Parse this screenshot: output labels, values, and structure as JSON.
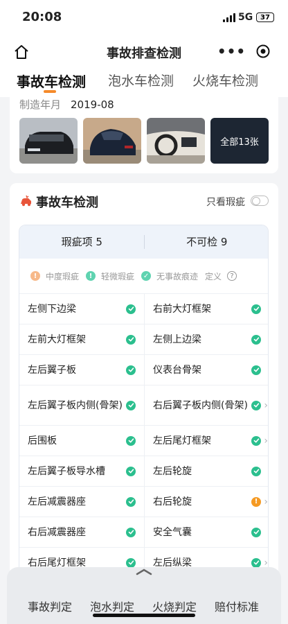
{
  "status_bar": {
    "time": "20:08",
    "network": "5G",
    "battery": "37",
    "battery_level": 0.37
  },
  "nav": {
    "title": "事故排查检测",
    "more_icon": "more-dots-icon",
    "close_icon": "target-icon",
    "home_icon": "home-icon"
  },
  "tabs": [
    {
      "label": "事故车检测",
      "active": true
    },
    {
      "label": "泡水车检测",
      "active": false
    },
    {
      "label": "火烧车检测",
      "active": false
    }
  ],
  "vehicle": {
    "mfg_label": "制造年月",
    "mfg_value": "2019-08",
    "photos": [
      "car-front-photo",
      "car-rear-photo",
      "car-interior-photo"
    ],
    "all_photos_label": "全部13张"
  },
  "section": {
    "title": "事故车检测",
    "filter_label": "只看瑕疵",
    "filter_on": false,
    "summary": {
      "defects": "瑕疵项 5",
      "uncheckable": "不可检 9"
    },
    "legend": [
      {
        "label": "中度瑕疵",
        "color": "#f7b98a",
        "glyph": "!"
      },
      {
        "label": "轻微瑕疵",
        "color": "#5fd3b0",
        "glyph": "!"
      },
      {
        "label": "无事故痕迹",
        "color": "#5fd3b0",
        "glyph": "✓"
      }
    ],
    "definition_label": "定义",
    "rows": [
      [
        {
          "name": "左侧下边梁",
          "status": "ok"
        },
        {
          "name": "右前大灯框架",
          "status": "ok"
        }
      ],
      [
        {
          "name": "左前大灯框架",
          "status": "ok"
        },
        {
          "name": "左侧上边梁",
          "status": "ok"
        }
      ],
      [
        {
          "name": "左后翼子板",
          "status": "ok"
        },
        {
          "name": "仪表台骨架",
          "status": "ok"
        }
      ],
      [
        {
          "name": "左后翼子板内侧(骨架)",
          "status": "ok"
        },
        {
          "name": "右后翼子板内侧(骨架)",
          "status": "ok",
          "chevron": true
        }
      ],
      [
        {
          "name": "后围板",
          "status": "ok"
        },
        {
          "name": "左后尾灯框架",
          "status": "ok",
          "chevron": true
        }
      ],
      [
        {
          "name": "左后翼子板导水槽",
          "status": "ok"
        },
        {
          "name": "左后轮旋",
          "status": "ok"
        }
      ],
      [
        {
          "name": "左后减震器座",
          "status": "ok"
        },
        {
          "name": "右后轮旋",
          "status": "warn",
          "chevron": true
        }
      ],
      [
        {
          "name": "右后减震器座",
          "status": "ok"
        },
        {
          "name": "安全气囊",
          "status": "ok"
        }
      ],
      [
        {
          "name": "右后尾灯框架",
          "status": "ok"
        },
        {
          "name": "左后纵梁",
          "status": "ok",
          "chevron": true
        }
      ]
    ]
  },
  "bottom_nav": [
    "事故判定",
    "泡水判定",
    "火烧判定",
    "赔付标准"
  ]
}
